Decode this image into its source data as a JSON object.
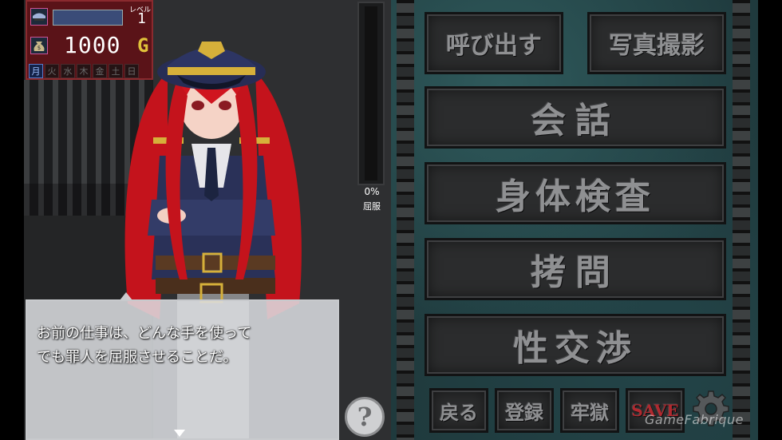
{
  "status": {
    "level_label": "レベル",
    "level_value": "1",
    "money_value": "1000",
    "money_unit": "G",
    "days": [
      "月",
      "火",
      "水",
      "木",
      "金",
      "土",
      "日"
    ],
    "active_day_index": 0
  },
  "gauge": {
    "value_percent": 0,
    "percent_text": "0%",
    "label": "屈服"
  },
  "dialog": {
    "text": "お前の仕事は、どんな手を使って\nでも罪人を屈服させることだ。"
  },
  "help": {
    "symbol": "?"
  },
  "menu": {
    "call_label": "呼び出す",
    "photo_label": "写真撮影",
    "talk_label": "会話",
    "inspect_label": "身体検査",
    "torture_label": "拷問",
    "negotiate_label": "性交渉",
    "back_label": "戻る",
    "register_label": "登録",
    "jail_label": "牢獄",
    "save_label": "SAVE"
  },
  "icons": [
    "cap-icon",
    "money-bag-icon",
    "gear-icon",
    "help-icon",
    "next-arrow-icon"
  ],
  "colors": {
    "status_bg": "#5a1318",
    "menu_bg": "#1f3a3d",
    "save_text": "#b0292f",
    "gauge_fill": "#b2304a"
  },
  "watermark": "GameFabrique"
}
